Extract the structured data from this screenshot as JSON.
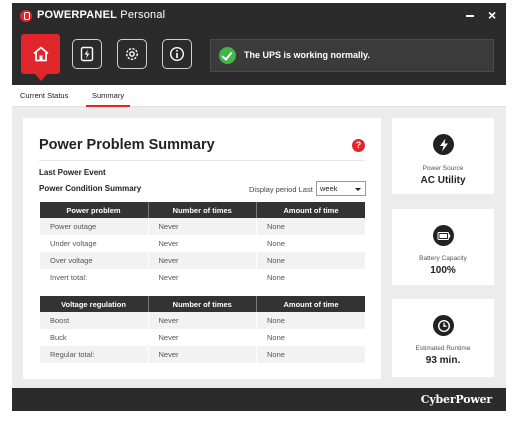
{
  "app": {
    "title_bold": "POWERPANEL",
    "title_light": " Personal",
    "brand": "CyberPower"
  },
  "status": {
    "message": "The UPS is working normally."
  },
  "tabs": [
    {
      "label": "Current Status"
    },
    {
      "label": "Summary"
    }
  ],
  "toolbar_icons": [
    "home-icon",
    "power-event-icon",
    "settings-icon",
    "info-icon"
  ],
  "summary": {
    "title": "Power Problem Summary",
    "help": "?",
    "last_event_label": "Last Power Event",
    "condition_label": "Power Condition Summary",
    "period_label": "Display period Last",
    "period_value": "week"
  },
  "power_table": {
    "headers": [
      "Power problem",
      "Number of times",
      "Amount of time"
    ],
    "rows": [
      [
        "Power outage",
        "Never",
        "None"
      ],
      [
        "Under voltage",
        "Never",
        "None"
      ],
      [
        "Over voltage",
        "Never",
        "None"
      ],
      [
        "Invert total:",
        "Never",
        "None"
      ]
    ]
  },
  "voltage_table": {
    "headers": [
      "Voltage regulation",
      "Number of times",
      "Amount of time"
    ],
    "rows": [
      [
        "Boost",
        "Never",
        "None"
      ],
      [
        "Buck",
        "Never",
        "None"
      ],
      [
        "Regular total:",
        "Never",
        "None"
      ]
    ]
  },
  "cards": {
    "source": {
      "label": "Power Source",
      "value": "AC Utility",
      "icon": "lightning-icon"
    },
    "battery": {
      "label": "Battery Capacity",
      "value": "100%",
      "icon": "battery-icon"
    },
    "runtime": {
      "label": "Estimated Runtime",
      "value": "93 min.",
      "icon": "clock-icon"
    }
  },
  "colors": {
    "accent": "#e0262b",
    "dark": "#2b2b2b",
    "ok": "#3fb54a"
  }
}
